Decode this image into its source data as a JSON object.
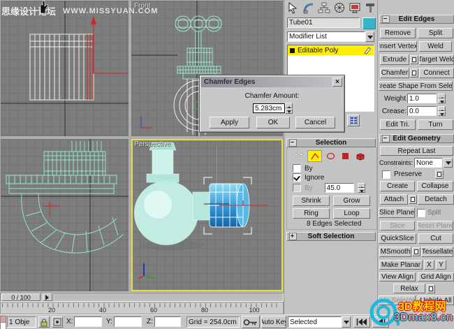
{
  "watermarks": {
    "forum_name": "思缘设计论坛",
    "forum_url": "WWW.MISSYUAN.COM",
    "logo_line1": "3D教程网",
    "logo_line2": "3Dmax8.cn"
  },
  "viewports": {
    "front_label": "Front",
    "perspective_label": "Perspective"
  },
  "dialog": {
    "title": "Chamfer Edges",
    "close": "×",
    "amount_label": "Chamfer Amount:",
    "amount_value": "5.283cm",
    "apply_label": "Apply",
    "ok_label": "OK",
    "cancel_label": "Cancel"
  },
  "command_panel": {
    "object_name": "Tube01",
    "modifier_list_label": "Modifier List",
    "stack_item_label": "Editable Poly",
    "selection": {
      "header": "Selection",
      "by_vertex_label": "By",
      "ignore_label": "Ignore",
      "by_angle_label": "By",
      "angle_value": "45.0",
      "shrink_label": "Shrink",
      "grow_label": "Grow",
      "ring_label": "Ring",
      "loop_label": "Loop",
      "status_text": "8 Edges Selected"
    },
    "soft_selection_header": "Soft Selection",
    "edit_edges": {
      "header": "Edit Edges",
      "remove": "Remove",
      "split": "Split",
      "insert_vertex": "Insert Vertex",
      "weld": "Weld",
      "extrude": "Extrude",
      "target_weld": "Target Weld",
      "chamfer": "Chamfer",
      "connect": "Connect",
      "create_shape": "Create Shape From Selec",
      "weight_label": "Weight",
      "weight_value": "1.0",
      "crease_label": "Crease:",
      "crease_value": "0.0",
      "edit_tri": "Edit Tri.",
      "turn": "Turn"
    },
    "edit_geometry": {
      "header": "Edit Geometry",
      "repeat_last": "Repeat Last",
      "constraints_label": "Constraints:",
      "constraints_value": "None",
      "preserve_label": "Preserve",
      "create": "Create",
      "collapse": "Collapse",
      "attach": "Attach",
      "detach": "Detach",
      "slice_plane": "Slice Plane",
      "split_label": "Split",
      "slice": "Slice",
      "reset_plane": "Reset Plane",
      "quickslice": "QuickSlice",
      "cut": "Cut",
      "msmooth": "MSmooth",
      "tessellate": "Tessellate",
      "make_planar": "Make Planar",
      "x_label": "X",
      "y_label": "Y",
      "view_align": "View Align",
      "grid_align": "Grid Align",
      "relax": "Relax",
      "hide_selected": "Hide Selected",
      "unhide_all": "Unhide All"
    }
  },
  "timeline": {
    "slider_label": "0 / 100",
    "ticks": [
      "20",
      "40",
      "60",
      "80",
      "100"
    ]
  },
  "status_bar": {
    "selection_text": "1 Obje",
    "x_label": "X:",
    "y_label": "Y:",
    "z_label": "Z:",
    "grid_text": "Grid = 254.0cm",
    "auto_key_label": "Auto Key",
    "selected_filter": "Selected"
  },
  "colors": {
    "object_color_swatch": "#35b4c6",
    "active_viewport_border": "#e3df3a",
    "stack_highlight": "#ffee00"
  }
}
